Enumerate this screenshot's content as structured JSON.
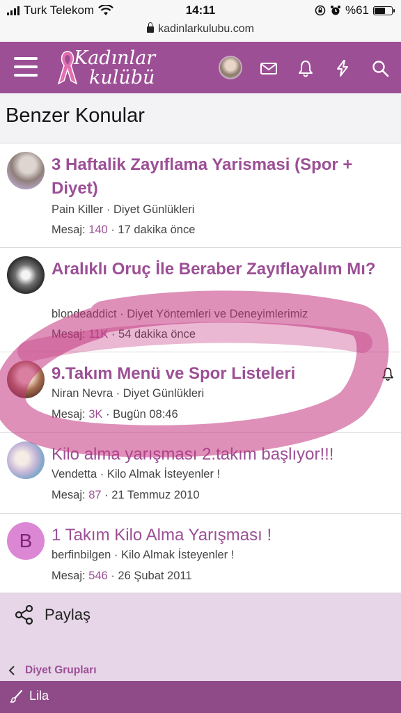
{
  "status_bar": {
    "carrier": "Turk Telekom",
    "time": "14:11",
    "battery": "%61",
    "battery_level": 0.61
  },
  "browser": {
    "url": "kadinlarkulubu.com"
  },
  "header": {
    "logo_line1": "Kadınlar",
    "logo_line2": "kulübü",
    "brand_color": "#9c4f95"
  },
  "section": {
    "title": "Benzer Konular"
  },
  "threads": [
    {
      "title": "3 Haftalik Zayıflama Yarismasi (Spor + Diyet)",
      "author": "Pain Killer",
      "forum": "Diyet Günlükleri",
      "replies_label": "Mesaj:",
      "replies": "140",
      "time": "17 dakika önce",
      "bold": true
    },
    {
      "title": "Aralıklı Oruç İle Beraber Zayıflayalım Mı?",
      "author": "blondeaddict",
      "forum": "Diyet Yöntemleri ve Deneyimlerimiz",
      "replies_label": "Mesaj:",
      "replies": "11K",
      "time": "54 dakika önce",
      "bold": true
    },
    {
      "title": "9.Takım Menü ve Spor Listeleri",
      "author": "Niran Nevra",
      "forum": "Diyet Günlükleri",
      "replies_label": "Mesaj:",
      "replies": "3K",
      "time": "Bugün 08:46",
      "bold": true,
      "watched": true
    },
    {
      "title": "Kilo alma yarışması 2.takım başlıyor!!!",
      "author": "Vendetta",
      "forum": "Kilo Almak İsteyenler !",
      "replies_label": "Mesaj:",
      "replies": "87",
      "time": "21 Temmuz 2010",
      "bold": false
    },
    {
      "title": "1 Takım Kilo Alma Yarışması !",
      "author": "berfinbilgen",
      "forum": "Kilo Almak İsteyenler !",
      "replies_label": "Mesaj:",
      "replies": "546",
      "time": "26 Şubat 2011",
      "bold": false,
      "avatar_letter": "B"
    }
  ],
  "share": {
    "label": "Paylaş"
  },
  "breadcrumb": {
    "label": "Diyet Grupları"
  },
  "footer": {
    "style_label": "Lila"
  },
  "icons": [
    "wifi-icon",
    "lock-icon",
    "hamburger-menu-icon",
    "mail-icon",
    "bell-icon",
    "lightning-icon",
    "search-icon",
    "share-icon",
    "chevron-left-icon",
    "brush-icon"
  ]
}
